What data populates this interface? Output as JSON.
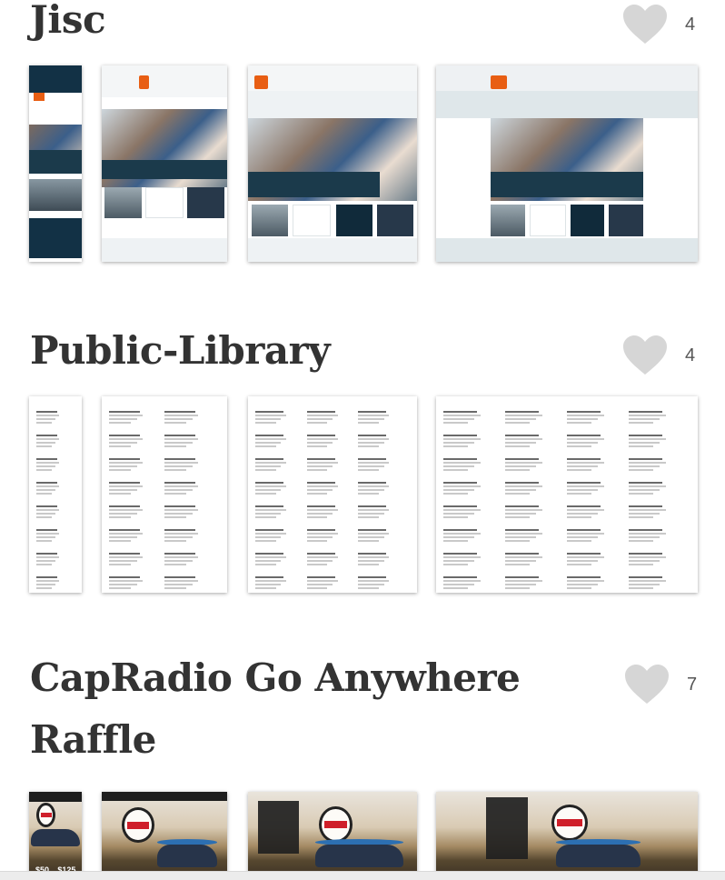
{
  "projects": [
    {
      "title": "Jisc",
      "likes": "4"
    },
    {
      "title": "Public-Library",
      "likes": "4"
    },
    {
      "title_line1": "CapRadio Go Anywhere",
      "title_line2": "Raffle",
      "likes": "7"
    }
  ],
  "colors": {
    "heart": "#d6d6d6",
    "jisc_orange": "#e85e13",
    "jisc_navy": "#1b3a4b",
    "cap_red": "#cf1f2a"
  },
  "icons": {
    "like": "heart-icon"
  },
  "cap_mobile_prices": [
    "$50",
    "$125"
  ]
}
